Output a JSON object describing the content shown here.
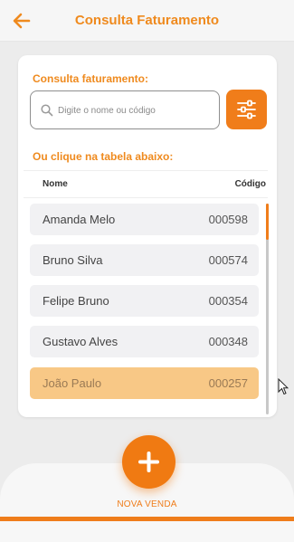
{
  "header": {
    "title": "Consulta Faturamento",
    "back_icon": "arrow-left-icon"
  },
  "search": {
    "label": "Consulta faturamento:",
    "placeholder": "Digite o nome ou código",
    "value": "",
    "icon": "search-icon",
    "filter_icon": "sliders-icon"
  },
  "table": {
    "label": "Ou clique na tabela abaixo:",
    "columns": {
      "name": "Nome",
      "code": "Código"
    },
    "rows": [
      {
        "name": "Amanda Melo",
        "code": "000598",
        "selected": false
      },
      {
        "name": "Bruno Silva",
        "code": "000574",
        "selected": false
      },
      {
        "name": "Felipe Bruno",
        "code": "000354",
        "selected": false
      },
      {
        "name": "Gustavo Alves",
        "code": "000348",
        "selected": false
      },
      {
        "name": "João Paulo",
        "code": "000257",
        "selected": true
      }
    ]
  },
  "fab": {
    "label": "NOVA VENDA",
    "icon": "plus-icon"
  },
  "colors": {
    "accent": "#f07d1a",
    "selected_row": "#f8c886",
    "row_background": "#f1f1f3"
  }
}
